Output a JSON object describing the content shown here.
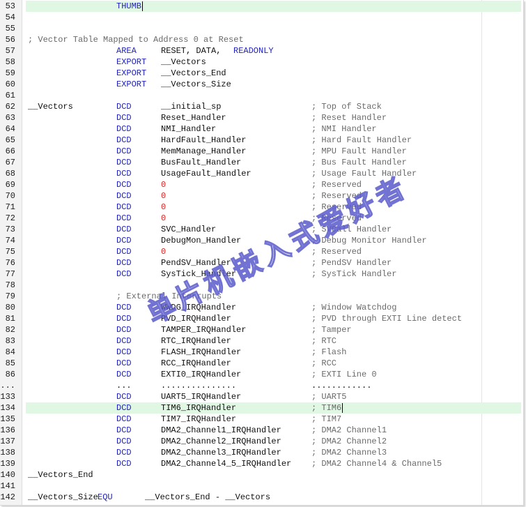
{
  "editor": {
    "colors": {
      "keyword": "#1f1fbf",
      "text": "#101010",
      "comment": "#6a6a6a",
      "number": "#e02020",
      "highlight": "#dff7e3"
    },
    "lines": [
      {
        "n": "53",
        "hl": true,
        "caret": true,
        "tokens": [
          {
            "t": "THUMB",
            "k": "kw",
            "c": 4
          }
        ]
      },
      {
        "n": "54",
        "tokens": []
      },
      {
        "n": "55",
        "tokens": []
      },
      {
        "n": "56",
        "tokens": [
          {
            "t": "; Vector Table Mapped to Address 0 at Reset",
            "k": "cm",
            "c": 0
          }
        ]
      },
      {
        "n": "57",
        "tokens": [
          {
            "t": "AREA",
            "k": "kw",
            "c": 4
          },
          {
            "t": "RESET, DATA,",
            "k": "txt",
            "c": 6
          },
          {
            "t": "READONLY",
            "k": "kw",
            "c": 6.5
          }
        ]
      },
      {
        "n": "58",
        "tokens": [
          {
            "t": "EXPORT",
            "k": "kw",
            "c": 4
          },
          {
            "t": "__Vectors",
            "k": "txt",
            "c": 6
          }
        ]
      },
      {
        "n": "59",
        "tokens": [
          {
            "t": "EXPORT",
            "k": "kw",
            "c": 4
          },
          {
            "t": "__Vectors_End",
            "k": "txt",
            "c": 6
          }
        ]
      },
      {
        "n": "60",
        "tokens": [
          {
            "t": "EXPORT",
            "k": "kw",
            "c": 4
          },
          {
            "t": "__Vectors_Size",
            "k": "txt",
            "c": 6
          }
        ]
      },
      {
        "n": "61",
        "tokens": []
      },
      {
        "n": "62",
        "tokens": [
          {
            "t": "__Vectors",
            "k": "txt",
            "c": 0
          },
          {
            "t": "DCD",
            "k": "kw",
            "c": 4
          },
          {
            "t": "__initial_sp",
            "k": "txt",
            "c": 6
          },
          {
            "t": "; Top of Stack",
            "k": "cm",
            "c": 12
          }
        ]
      },
      {
        "n": "63",
        "tokens": [
          {
            "t": "DCD",
            "k": "kw",
            "c": 4
          },
          {
            "t": "Reset_Handler",
            "k": "txt",
            "c": 6
          },
          {
            "t": "; Reset Handler",
            "k": "cm",
            "c": 12
          }
        ]
      },
      {
        "n": "64",
        "tokens": [
          {
            "t": "DCD",
            "k": "kw",
            "c": 4
          },
          {
            "t": "NMI_Handler",
            "k": "txt",
            "c": 6
          },
          {
            "t": "; NMI Handler",
            "k": "cm",
            "c": 12
          }
        ]
      },
      {
        "n": "65",
        "tokens": [
          {
            "t": "DCD",
            "k": "kw",
            "c": 4
          },
          {
            "t": "HardFault_Handler",
            "k": "txt",
            "c": 6
          },
          {
            "t": "; Hard Fault Handler",
            "k": "cm",
            "c": 12
          }
        ]
      },
      {
        "n": "66",
        "tokens": [
          {
            "t": "DCD",
            "k": "kw",
            "c": 4
          },
          {
            "t": "MemManage_Handler",
            "k": "txt",
            "c": 6
          },
          {
            "t": "; MPU Fault Handler",
            "k": "cm",
            "c": 12
          }
        ]
      },
      {
        "n": "67",
        "tokens": [
          {
            "t": "DCD",
            "k": "kw",
            "c": 4
          },
          {
            "t": "BusFault_Handler",
            "k": "txt",
            "c": 6
          },
          {
            "t": "; Bus Fault Handler",
            "k": "cm",
            "c": 12
          }
        ]
      },
      {
        "n": "68",
        "tokens": [
          {
            "t": "DCD",
            "k": "kw",
            "c": 4
          },
          {
            "t": "UsageFault_Handler",
            "k": "txt",
            "c": 6
          },
          {
            "t": "; Usage Fault Handler",
            "k": "cm",
            "c": 12
          }
        ]
      },
      {
        "n": "69",
        "tokens": [
          {
            "t": "DCD",
            "k": "kw",
            "c": 4
          },
          {
            "t": "0",
            "k": "num",
            "c": 6
          },
          {
            "t": "; Reserved",
            "k": "cm",
            "c": 12
          }
        ]
      },
      {
        "n": "70",
        "tokens": [
          {
            "t": "DCD",
            "k": "kw",
            "c": 4
          },
          {
            "t": "0",
            "k": "num",
            "c": 6
          },
          {
            "t": "; Reserved",
            "k": "cm",
            "c": 12
          }
        ]
      },
      {
        "n": "71",
        "tokens": [
          {
            "t": "DCD",
            "k": "kw",
            "c": 4
          },
          {
            "t": "0",
            "k": "num",
            "c": 6
          },
          {
            "t": "; Reserved",
            "k": "cm",
            "c": 12
          }
        ]
      },
      {
        "n": "72",
        "tokens": [
          {
            "t": "DCD",
            "k": "kw",
            "c": 4
          },
          {
            "t": "0",
            "k": "num",
            "c": 6
          },
          {
            "t": "; Reserved",
            "k": "cm",
            "c": 12
          }
        ]
      },
      {
        "n": "73",
        "tokens": [
          {
            "t": "DCD",
            "k": "kw",
            "c": 4
          },
          {
            "t": "SVC_Handler",
            "k": "txt",
            "c": 6
          },
          {
            "t": "; SVCall Handler",
            "k": "cm",
            "c": 12
          }
        ]
      },
      {
        "n": "74",
        "tokens": [
          {
            "t": "DCD",
            "k": "kw",
            "c": 4
          },
          {
            "t": "DebugMon_Handler",
            "k": "txt",
            "c": 6
          },
          {
            "t": "; Debug Monitor Handler",
            "k": "cm",
            "c": 12
          }
        ]
      },
      {
        "n": "75",
        "tokens": [
          {
            "t": "DCD",
            "k": "kw",
            "c": 4
          },
          {
            "t": "0",
            "k": "num",
            "c": 6
          },
          {
            "t": "; Reserved",
            "k": "cm",
            "c": 12
          }
        ]
      },
      {
        "n": "76",
        "tokens": [
          {
            "t": "DCD",
            "k": "kw",
            "c": 4
          },
          {
            "t": "PendSV_Handler",
            "k": "txt",
            "c": 6
          },
          {
            "t": "; PendSV Handler",
            "k": "cm",
            "c": 12
          }
        ]
      },
      {
        "n": "77",
        "tokens": [
          {
            "t": "DCD",
            "k": "kw",
            "c": 4
          },
          {
            "t": "SysTick_Handler",
            "k": "txt",
            "c": 6
          },
          {
            "t": "; SysTick Handler",
            "k": "cm",
            "c": 12
          }
        ]
      },
      {
        "n": "78",
        "tokens": []
      },
      {
        "n": "79",
        "tokens": [
          {
            "t": "; External Interrupts",
            "k": "cm",
            "c": 4
          }
        ]
      },
      {
        "n": "80",
        "tokens": [
          {
            "t": "DCD",
            "k": "kw",
            "c": 4
          },
          {
            "t": "WWDG_IRQHandler",
            "k": "txt",
            "c": 6
          },
          {
            "t": "; Window Watchdog",
            "k": "cm",
            "c": 12
          }
        ]
      },
      {
        "n": "81",
        "tokens": [
          {
            "t": "DCD",
            "k": "kw",
            "c": 4
          },
          {
            "t": "PVD_IRQHandler",
            "k": "txt",
            "c": 6
          },
          {
            "t": "; PVD through EXTI Line detect",
            "k": "cm",
            "c": 12
          }
        ]
      },
      {
        "n": "82",
        "tokens": [
          {
            "t": "DCD",
            "k": "kw",
            "c": 4
          },
          {
            "t": "TAMPER_IRQHandler",
            "k": "txt",
            "c": 6
          },
          {
            "t": "; Tamper",
            "k": "cm",
            "c": 12
          }
        ]
      },
      {
        "n": "83",
        "tokens": [
          {
            "t": "DCD",
            "k": "kw",
            "c": 4
          },
          {
            "t": "RTC_IRQHandler",
            "k": "txt",
            "c": 6
          },
          {
            "t": "; RTC",
            "k": "cm",
            "c": 12
          }
        ]
      },
      {
        "n": "84",
        "tokens": [
          {
            "t": "DCD",
            "k": "kw",
            "c": 4
          },
          {
            "t": "FLASH_IRQHandler",
            "k": "txt",
            "c": 6
          },
          {
            "t": "; Flash",
            "k": "cm",
            "c": 12
          }
        ]
      },
      {
        "n": "85",
        "tokens": [
          {
            "t": "DCD",
            "k": "kw",
            "c": 4
          },
          {
            "t": "RCC_IRQHandler",
            "k": "txt",
            "c": 6
          },
          {
            "t": "; RCC",
            "k": "cm",
            "c": 12
          }
        ]
      },
      {
        "n": "86",
        "tokens": [
          {
            "t": "DCD",
            "k": "kw",
            "c": 4
          },
          {
            "t": "EXTI0_IRQHandler",
            "k": "txt",
            "c": 6
          },
          {
            "t": "; EXTI Line 0",
            "k": "cm",
            "c": 12
          }
        ]
      },
      {
        "n": "...",
        "tokens": [
          {
            "t": "...",
            "k": "txt",
            "c": 4
          },
          {
            "t": "...............",
            "k": "txt",
            "c": 6
          },
          {
            "t": "............",
            "k": "txt",
            "c": 12
          }
        ]
      },
      {
        "n": "133",
        "tokens": [
          {
            "t": "DCD",
            "k": "kw",
            "c": 4
          },
          {
            "t": "UART5_IRQHandler",
            "k": "txt",
            "c": 6
          },
          {
            "t": "; UART5",
            "k": "cm",
            "c": 12
          }
        ]
      },
      {
        "n": "134",
        "hl": true,
        "caret": true,
        "tokens": [
          {
            "t": "DCD",
            "k": "kw",
            "c": 4
          },
          {
            "t": "TIM6_IRQHandler",
            "k": "txt",
            "c": 6
          },
          {
            "t": "; TIM6",
            "k": "cm",
            "c": 12
          }
        ]
      },
      {
        "n": "135",
        "tokens": [
          {
            "t": "DCD",
            "k": "kw",
            "c": 4
          },
          {
            "t": "TIM7_IRQHandler",
            "k": "txt",
            "c": 6
          },
          {
            "t": "; TIM7",
            "k": "cm",
            "c": 12
          }
        ]
      },
      {
        "n": "136",
        "tokens": [
          {
            "t": "DCD",
            "k": "kw",
            "c": 4
          },
          {
            "t": "DMA2_Channel1_IRQHandler",
            "k": "txt",
            "c": 6
          },
          {
            "t": "; DMA2 Channel1",
            "k": "cm",
            "c": 12
          }
        ]
      },
      {
        "n": "137",
        "tokens": [
          {
            "t": "DCD",
            "k": "kw",
            "c": 4
          },
          {
            "t": "DMA2_Channel2_IRQHandler",
            "k": "txt",
            "c": 6
          },
          {
            "t": "; DMA2 Channel2",
            "k": "cm",
            "c": 12
          }
        ]
      },
      {
        "n": "138",
        "tokens": [
          {
            "t": "DCD",
            "k": "kw",
            "c": 4
          },
          {
            "t": "DMA2_Channel3_IRQHandler",
            "k": "txt",
            "c": 6
          },
          {
            "t": "; DMA2 Channel3",
            "k": "cm",
            "c": 12
          }
        ]
      },
      {
        "n": "139",
        "tokens": [
          {
            "t": "DCD",
            "k": "kw",
            "c": 4
          },
          {
            "t": "DMA2_Channel4_5_IRQHandler",
            "k": "txt",
            "c": 6
          },
          {
            "t": "; DMA2 Channel4 & Channel5",
            "k": "cm",
            "c": 12
          }
        ]
      },
      {
        "n": "140",
        "tokens": [
          {
            "t": "__Vectors_End",
            "k": "txt",
            "c": 0
          }
        ]
      },
      {
        "n": "141",
        "tokens": []
      },
      {
        "n": "142",
        "tokens": [
          {
            "t": "__Vectors_Size",
            "k": "txt",
            "c": 0
          },
          {
            "t": "EQU",
            "k": "kw",
            "c": 3.55
          },
          {
            "t": "__Vectors_End - __Vectors",
            "k": "txt",
            "c": 5.2
          }
        ]
      }
    ]
  },
  "watermark": {
    "text": "单片机嵌入式爱好者",
    "color": "#5a5acc"
  }
}
